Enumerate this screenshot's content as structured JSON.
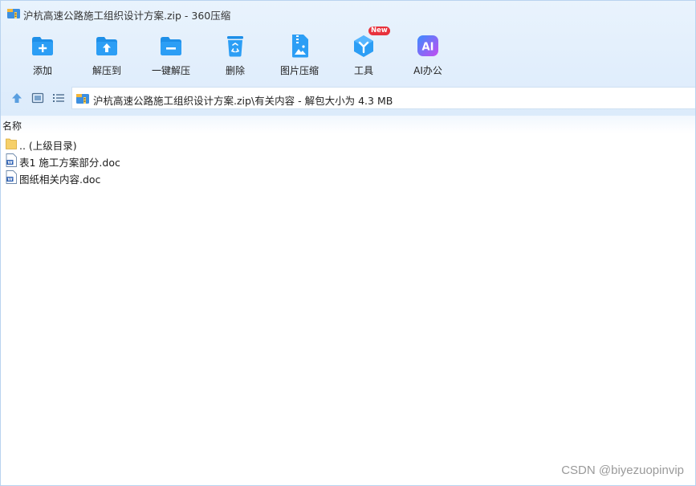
{
  "window": {
    "title": "沪杭高速公路施工组织设计方案.zip - 360压缩"
  },
  "toolbar": {
    "items": [
      {
        "label": "添加",
        "icon": "folder-add-icon"
      },
      {
        "label": "解压到",
        "icon": "folder-extract-icon"
      },
      {
        "label": "一键解压",
        "icon": "one-click-extract-icon"
      },
      {
        "label": "删除",
        "icon": "recycle-bin-icon"
      },
      {
        "label": "图片压缩",
        "icon": "image-compress-icon"
      },
      {
        "label": "工具",
        "icon": "tools-icon",
        "badge": "New"
      },
      {
        "label": "AI办公",
        "icon": "ai-office-icon",
        "icon_text": "AI"
      }
    ]
  },
  "address": {
    "path": "沪杭高速公路施工组织设计方案.zip\\有关内容 - 解包大小为 4.3 MB"
  },
  "list": {
    "header_name": "名称",
    "rows": [
      {
        "name": ".. (上级目录)",
        "icon": "folder-icon"
      },
      {
        "name": "表1 施工方案部分.doc",
        "icon": "word-doc-icon"
      },
      {
        "name": "图纸相关内容.doc",
        "icon": "word-doc-icon"
      }
    ]
  },
  "watermark": "CSDN @biyezuopinvip",
  "colors": {
    "accent_blue": "#1e8fe8",
    "chrome_bg": "#dcebfb",
    "badge_red": "#e8323c",
    "ai_gradient_start": "#3a8dff",
    "ai_gradient_end": "#c44cf0"
  }
}
